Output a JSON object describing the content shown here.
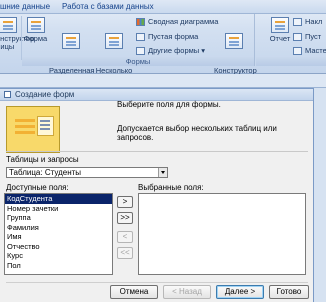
{
  "ribbon": {
    "tabs": [
      "шние данные",
      "Работа с базами данных"
    ],
    "left_partial": "онструктор\nлицы",
    "buttons": {
      "form": "Форма",
      "split_form": "Разделенная\nформа",
      "multiple_items": "Несколько\nэлементов",
      "pivot_chart": "Сводная диаграмма",
      "blank_form": "Пустая форма",
      "more_forms": "Другие формы ▾",
      "form_design": "Конструктор\nформ",
      "report": "Отчет",
      "report_wizard": "Накл",
      "report_blank": "Пуст",
      "report_more": "Масте"
    },
    "group_label": "Формы"
  },
  "dialog": {
    "title": "Создание форм",
    "intro_line1": "Выберите поля для формы.",
    "intro_line2": "Допускается выбор нескольких таблиц или запросов.",
    "tables_label": "Таблицы и запросы",
    "tables_value": "Таблица: Студенты",
    "available_label": "Доступные поля:",
    "selected_label": "Выбранные поля:",
    "available_fields": [
      "КодСтудента",
      "Номер зачетки",
      "Группа",
      "Фамилия",
      "Имя",
      "Отчество",
      "Курс",
      "Пол"
    ],
    "selected_fields": [],
    "arrows": {
      "add_one": ">",
      "add_all": ">>",
      "remove_one": "<",
      "remove_all": "<<"
    },
    "buttons": {
      "cancel": "Отмена",
      "back": "< Назад",
      "next": "Далее >",
      "finish": "Готово"
    }
  }
}
